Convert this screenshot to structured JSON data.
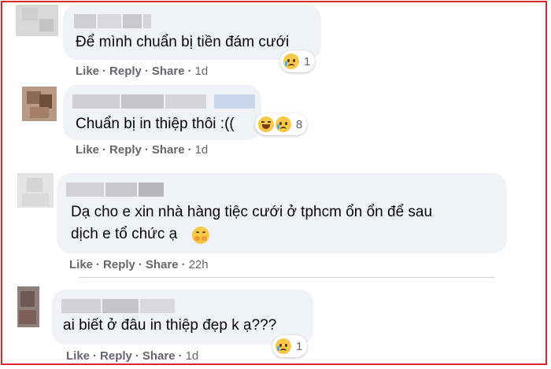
{
  "comments": [
    {
      "text_lines": [
        "Để mình chuẩn bị tiền đám cưới"
      ],
      "reaction": {
        "icons": [
          "sad-icon"
        ],
        "count": "1"
      },
      "actions": {
        "like": "Like",
        "reply": "Reply",
        "share": "Share",
        "time": "1d"
      }
    },
    {
      "text_lines": [
        "Chuẩn bị in thiệp thôi :(("
      ],
      "reaction": {
        "icons": [
          "haha-icon",
          "sad-icon"
        ],
        "count": "8"
      },
      "actions": {
        "like": "Like",
        "reply": "Reply",
        "share": "Share",
        "time": "1d"
      }
    },
    {
      "text_lines": [
        "Dạ cho e xin nhà hàng tiệc cưới ở tphcm ổn ổn để sau",
        "dịch e tổ chức ạ"
      ],
      "inline_emoji": "hugging-face-icon",
      "actions": {
        "like": "Like",
        "reply": "Reply",
        "share": "Share",
        "time": "22h"
      }
    },
    {
      "text_lines": [
        "ai biết ở đâu in thiệp đẹp k ạ???"
      ],
      "reaction": {
        "icons": [
          "sad-icon"
        ],
        "count": "1"
      },
      "actions": {
        "like": "Like",
        "reply": "Reply",
        "share": "Share",
        "time": "1d"
      }
    }
  ],
  "colors": {
    "frame": "#e0262b",
    "bubble": "#f0f2f5",
    "action_text": "#65676b",
    "text": "#050505"
  }
}
